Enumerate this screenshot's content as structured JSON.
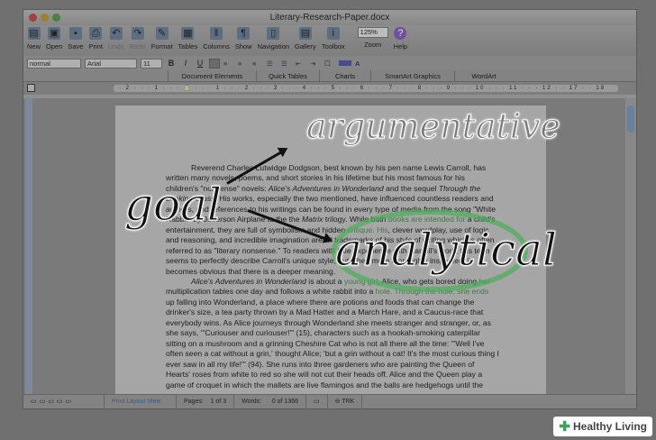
{
  "window": {
    "title": "Literary-Research-Paper.docx"
  },
  "toolbar": [
    {
      "label": "New",
      "icon": "new-document-icon",
      "glyph": "▤"
    },
    {
      "label": "Open",
      "icon": "open-folder-icon",
      "glyph": "▣"
    },
    {
      "label": "Save",
      "icon": "save-icon",
      "glyph": "▪"
    },
    {
      "label": "Print",
      "icon": "print-icon",
      "glyph": "⎙"
    },
    {
      "label": "Undo",
      "icon": "undo-icon",
      "glyph": "↶",
      "disabled": true
    },
    {
      "label": "Redo",
      "icon": "redo-icon",
      "glyph": "↷",
      "disabled": true
    },
    {
      "label": "Format",
      "icon": "format-brush-icon",
      "glyph": "✎"
    },
    {
      "label": "Tables",
      "icon": "table-icon",
      "glyph": "▦"
    },
    {
      "label": "Columns",
      "icon": "columns-icon",
      "glyph": "‖"
    },
    {
      "label": "Show",
      "icon": "pilcrow-icon",
      "glyph": "¶"
    },
    {
      "label": "Navigation",
      "icon": "navigation-icon",
      "glyph": "▯"
    },
    {
      "label": "Gallery",
      "icon": "gallery-icon",
      "glyph": "▤"
    },
    {
      "label": "Toolbox",
      "icon": "toolbox-icon",
      "glyph": "i"
    }
  ],
  "zoom": {
    "value": "125%",
    "label": "Zoom"
  },
  "help": {
    "label": "Help",
    "glyph": "?"
  },
  "format": {
    "style": "normal",
    "font": "Arial",
    "size": "11",
    "bold": "B",
    "italic": "I",
    "underline": "U"
  },
  "ribbon_tabs": [
    "Document Elements",
    "Quick Tables",
    "Charts",
    "SmartArt Graphics",
    "WordArt"
  ],
  "ruler": "· 2 · · · 1 · · · ⌛ · · · 1 · · · 2 · · · 3 · · · 4 · · · 5 · · · 6 · · · 7 · · · 8 · · · 9 · · · 10 · · · 11 · · · 12 · · 17 · · 18",
  "document": {
    "p1": [
      "Reverend Charles Lutwidge Dodgson, best known by his pen name Lewis Carroll, has written many novels, poems, and short stories in his lifetime but his most famous for his children's \"nonsense\" novels: ",
      "Alice's Adventures in Wonderland",
      " and the sequel ",
      "Through the Looking Glass",
      ". His works, especially the two mentioned, have influenced countless readers and authors, and references to his writings can be found in every type of media from the song \"White Rabbit\" by Jefferson Airplane to the the ",
      "Matrix",
      " trilogy. While both ",
      "books are intended for",
      " a child's entertainment, they are full of symbolism and hidden ",
      "critique. His",
      ", clever wordplay, use of logic and reasoning, and incredible imagination are all trademarks of his style of writing which is often referred to as \"literary nonsense.\" To readers with little experience with Carroll's work, this term seems to perfectly describe Carroll's unique style, but when more thoroughly inspected, it becomes obvious that there is a deeper meaning."
    ],
    "p2": [
      "Alice's Adventures in Wonderland",
      " is about a ",
      "young girl",
      ", Alice, who gets bored doing ",
      "her",
      " multiplication tables one day and follows a white rabbit into a ",
      "hole. Through the hole, she ends",
      " up falling into Wonderland, a place where there are potions and foods that can change the drinker's size, a tea party thrown by a Mad Hatter and a March Hare, and a Caucus-race that everybody wins. As Alice journeys through Wonderland she meets stranger and stranger, or, as she says, \"'Curiouser and curiouser!'\" (15), characters such as a hookah-smoking caterpillar sitting on a mushroom and a grinning Cheshire Cat who is not all there all the time: \"'Well I've often seen a cat without a grin,' thought Alice; 'but a grin without a cat! It's the most curious thing I ever saw in all my life!'\" (94). She runs into three gardeners who are painting the Queen of Hearts' roses from white to red so she will not cut their heads off. Alice and the Queen play a game of croquet in which the mallets are live flamingos and the balls are hedgehogs until the"
    ]
  },
  "status": {
    "view": "Print Layout View",
    "pages_label": "Pages:",
    "pages": "1 of 3",
    "words_label": "Words:",
    "words": "0 of 1366",
    "trk": "TRK"
  },
  "annotations": {
    "word1": "argumentative",
    "word2": "goal",
    "word3": "analytical"
  },
  "watermark": "Healthy Living",
  "colors": {
    "highlight_green": "#3f7a45",
    "circle_green": "#4caf5a"
  }
}
